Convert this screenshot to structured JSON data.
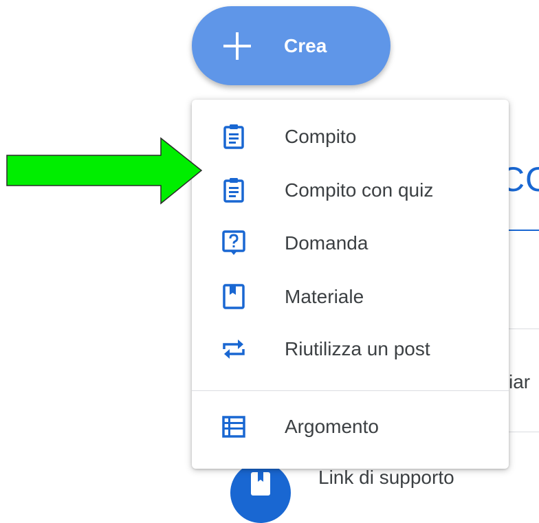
{
  "create_button": {
    "label": "Crea",
    "icon": "plus-icon"
  },
  "menu": {
    "items": [
      {
        "label": "Compito",
        "icon": "assignment-icon"
      },
      {
        "label": "Compito con quiz",
        "icon": "quiz-assignment-icon"
      },
      {
        "label": "Domanda",
        "icon": "question-icon"
      },
      {
        "label": "Materiale",
        "icon": "material-icon"
      },
      {
        "label": "Riutilizza un post",
        "icon": "reuse-post-icon"
      }
    ],
    "topic": {
      "label": "Argomento",
      "icon": "topic-list-icon"
    }
  },
  "background": {
    "heading_fragment": "CO",
    "text_fragment": "iar",
    "link_label": "Link di supporto"
  },
  "colors": {
    "accent": "#1967d2",
    "button": "#5f96e8",
    "arrow": "#00ee00"
  }
}
